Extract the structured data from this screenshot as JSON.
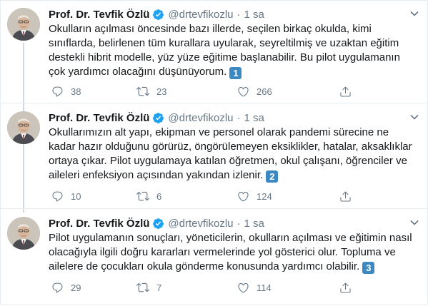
{
  "author": {
    "name": "Prof. Dr. Tevfik Özlü",
    "handle": "@drtevfikozlu",
    "separator": "·",
    "verified_color": "#1da1f2"
  },
  "tweets": [
    {
      "time": "1 sa",
      "lines": [
        "Okulların açılması öncesinde bazı illerde, seçilen birkaç okulda, kimi",
        "sınıflarda, belirlenen tüm kurallara uyularak, seyreltilmiş ve uzaktan eğitim",
        "destekli hibrit modelle, yüz yüze eğitime başlanabilir. Bu pilot uygulamanın",
        "çok yardımcı olacağını düşünüyorum."
      ],
      "badge": "1",
      "replies": "38",
      "retweets": "23",
      "likes": "266"
    },
    {
      "time": "1 sa",
      "lines": [
        "Okullarımızın alt yapı, ekipman ve personel olarak pandemi sürecine ne",
        "kadar hazır olduğunu görürüz, öngörülemeyen eksiklikler, hatalar, aksaklıklar",
        "ortaya çıkar. Pilot uygulamaya katılan öğretmen, okul çalışanı, öğrenciler ve",
        "aileleri enfeksiyon açısından yakından izlenir."
      ],
      "badge": "2",
      "replies": "10",
      "retweets": "6",
      "likes": "124"
    },
    {
      "time": "1 sa",
      "lines": [
        "Pilot uygulamanın sonuçları, yöneticilerin, okulların açılması ve eğitimin nasıl",
        "olacağıyla ilgili doğru kararları vermelerinde yol gösterici olur. Topluma ve",
        "ailelere de çocukları okula gönderme konusunda yardımcı olabilir."
      ],
      "badge": "3",
      "replies": "29",
      "retweets": "7",
      "likes": "114"
    }
  ],
  "icons": {
    "reply": "reply-icon",
    "retweet": "retweet-icon",
    "like": "heart-icon",
    "share": "share-icon",
    "more": "chevron-down-icon"
  },
  "colors": {
    "muted": "#657786",
    "thread_line": "#cfd9de",
    "badge": "#3b88c3"
  }
}
